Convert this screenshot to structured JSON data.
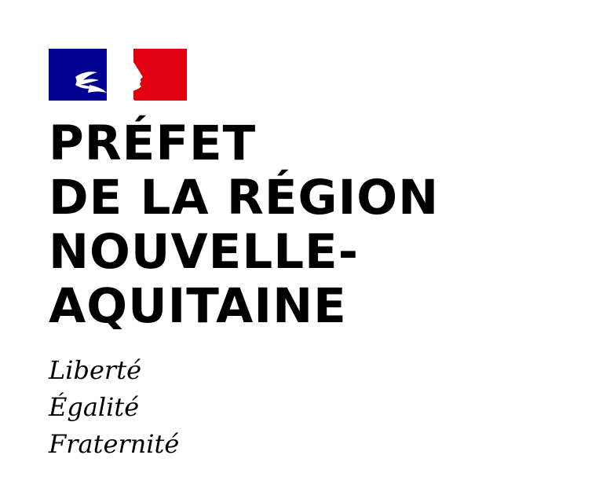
{
  "emblem": {
    "icon": "marianne-flag-icon",
    "colors": {
      "blue": "#000091",
      "white": "#ffffff",
      "red": "#e1000f"
    }
  },
  "title": {
    "lines": [
      "PRÉFET",
      "DE LA RÉGION",
      "NOUVELLE-",
      "AQUITAINE"
    ]
  },
  "motto": {
    "lines": [
      "Liberté",
      "Égalité",
      "Fraternité"
    ]
  }
}
